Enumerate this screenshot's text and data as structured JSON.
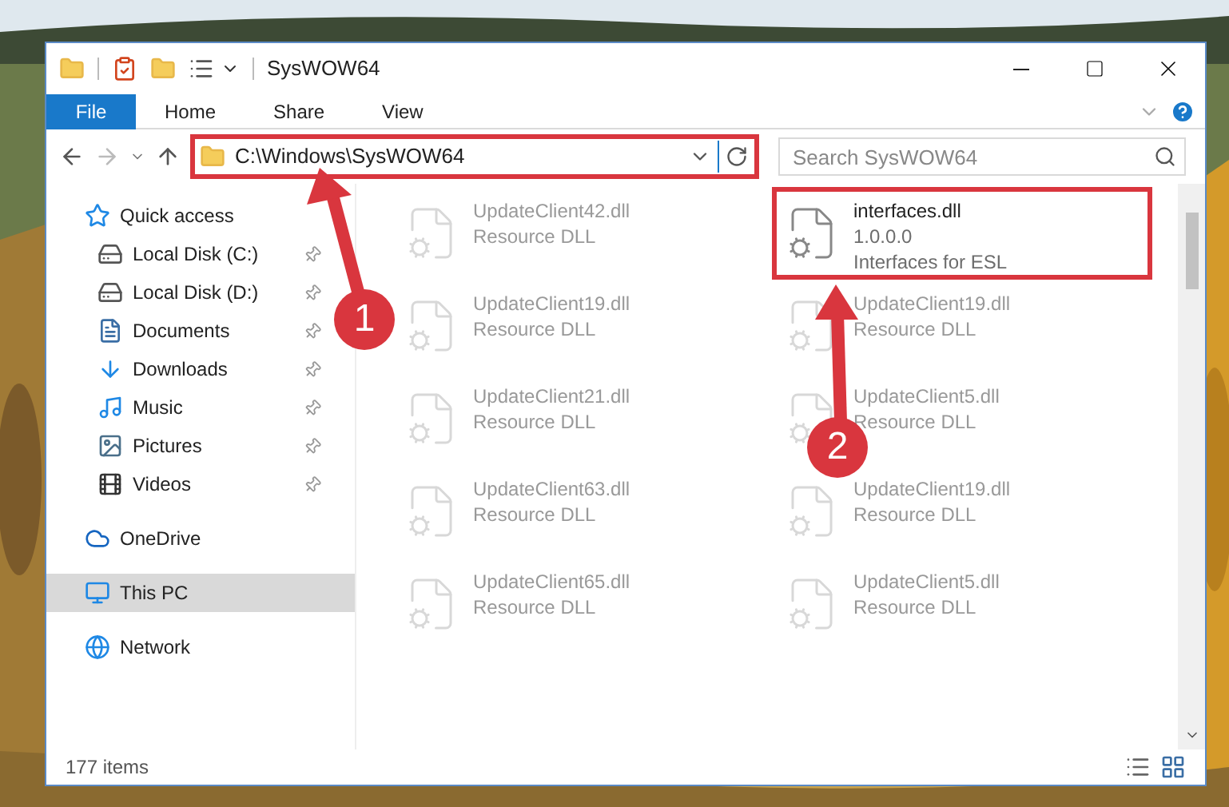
{
  "window": {
    "title": "SysWOW64"
  },
  "ribbon_tabs": [
    {
      "label": "File",
      "selected": true
    },
    {
      "label": "Home",
      "selected": false
    },
    {
      "label": "Share",
      "selected": false
    },
    {
      "label": "View",
      "selected": false
    }
  ],
  "address": {
    "path": "C:\\Windows\\SysWOW64",
    "highlighted": true
  },
  "search": {
    "placeholder": "Search SysWOW64"
  },
  "sidebar": {
    "items": [
      {
        "label": "Quick access",
        "selected": false,
        "children": [
          {
            "label": "Local Disk (C:)",
            "pinned": true
          },
          {
            "label": "Local Disk (D:)",
            "pinned": true
          },
          {
            "label": "Documents",
            "pinned": true
          },
          {
            "label": "Downloads",
            "pinned": true
          },
          {
            "label": "Music",
            "pinned": true
          },
          {
            "label": "Pictures",
            "pinned": true
          },
          {
            "label": "Videos",
            "pinned": true
          }
        ]
      },
      {
        "label": "OneDrive",
        "selected": false
      },
      {
        "label": "This PC",
        "selected": true
      },
      {
        "label": "Network",
        "selected": false
      }
    ]
  },
  "files": [
    {
      "name": "UpdateClient42.dll",
      "type": "Resource DLL",
      "faded": true,
      "highlighted": false
    },
    {
      "name": "interfaces.dll",
      "version": "1.0.0.0",
      "type": "Interfaces for ESL",
      "faded": false,
      "highlighted": true
    },
    {
      "name": "UpdateClient19.dll",
      "type": "Resource DLL",
      "faded": true,
      "highlighted": false
    },
    {
      "name": "UpdateClient19.dll",
      "type": "Resource DLL",
      "faded": true,
      "highlighted": false
    },
    {
      "name": "UpdateClient21.dll",
      "type": "Resource DLL",
      "faded": true,
      "highlighted": false
    },
    {
      "name": "UpdateClient5.dll",
      "type": "Resource DLL",
      "faded": true,
      "highlighted": false
    },
    {
      "name": "UpdateClient63.dll",
      "type": "Resource DLL",
      "faded": true,
      "highlighted": false
    },
    {
      "name": "UpdateClient19.dll",
      "type": "Resource DLL",
      "faded": true,
      "highlighted": false
    },
    {
      "name": "UpdateClient65.dll",
      "type": "Resource DLL",
      "faded": true,
      "highlighted": false
    },
    {
      "name": "UpdateClient5.dll",
      "type": "Resource DLL",
      "faded": true,
      "highlighted": false
    }
  ],
  "status_bar": {
    "count": "177 items"
  },
  "callouts": [
    {
      "number": "1"
    },
    {
      "number": "2"
    }
  ]
}
